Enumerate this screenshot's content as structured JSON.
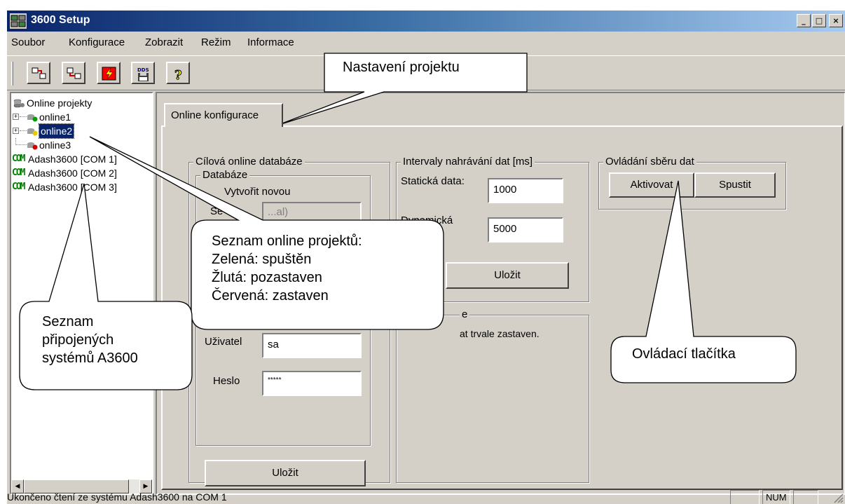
{
  "window": {
    "title": "3600 Setup",
    "controls": [
      "_",
      "□",
      "×"
    ]
  },
  "menu": [
    "Soubor",
    "Konfigurace",
    "Zobrazit",
    "Režim",
    "Informace"
  ],
  "toolbar": {
    "icons": [
      "download-config-icon",
      "upload-config-icon",
      "activate-icon",
      "dds-save-icon",
      "help-icon"
    ],
    "dds_label": "DDS",
    "help_glyph": "?"
  },
  "tree": {
    "root": "Online projekty",
    "projects": [
      {
        "label": "online1",
        "status_color": "#00a000"
      },
      {
        "label": "online2",
        "status_color": "#e8c800",
        "selected": true
      },
      {
        "label": "online3",
        "status_color": "#d00000"
      }
    ],
    "com_badge": "COM",
    "devices": [
      "Adash3600 [COM 1]",
      "Adash3600 [COM 2]",
      "Adash3600 [COM 3]"
    ]
  },
  "tab": {
    "label": "Online konfigurace"
  },
  "db_group": {
    "title": "Cílová online databáze",
    "sub_title": "Databáze",
    "create_new_label": "Vytvořit novou",
    "server_label": "Se",
    "server_value": "...al)",
    "user_label": "Uživatel",
    "user_value": "sa",
    "password_label": "Heslo",
    "password_value": "*****",
    "save_label": "Uložit"
  },
  "intervals_group": {
    "title": "Intervaly nahrávání dat [ms]",
    "static_label": "Statická data:",
    "static_value": "1000",
    "dynamic_label": "Dynamická",
    "dynamic_value": "5000",
    "save_label": "Uložit"
  },
  "state_group": {
    "title_fragment": "e",
    "text_fragment": "at trvale zastaven."
  },
  "control_group": {
    "title": "Ovládání sběru dat",
    "activate_label": "Aktivovat",
    "start_label": "Spustit"
  },
  "callouts": {
    "project_settings": "Nastavení projektu",
    "project_list": [
      "Seznam online projektů:",
      "Zelená: spuštěn",
      "Žlutá: pozastaven",
      "Červená: zastaven"
    ],
    "systems_list": [
      "Seznam",
      "připojených",
      "systémů A3600"
    ],
    "control_buttons": "Ovládací tlačítka"
  },
  "status": {
    "text": "Ukončeno čtení ze systému Adash3600 na COM 1",
    "num": "NUM"
  }
}
